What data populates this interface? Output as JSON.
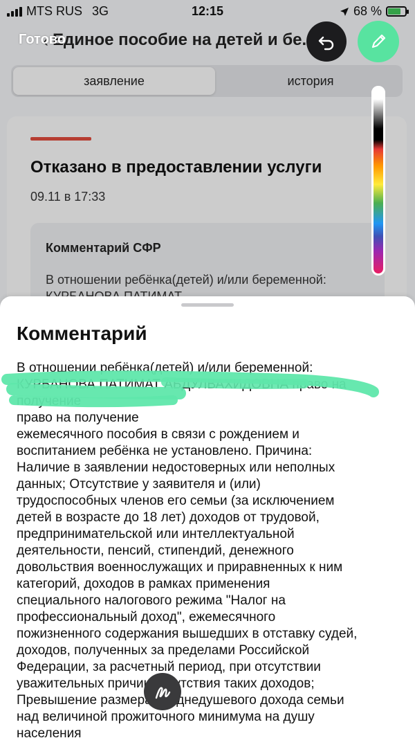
{
  "status_bar": {
    "carrier": "MTS RUS",
    "network": "3G",
    "time": "12:15",
    "battery_percent": "68 %",
    "battery_level": 0.68
  },
  "header": {
    "done_label": "Готово",
    "title": "Единое пособие на детей и бе..."
  },
  "tabs": [
    {
      "label": "заявление",
      "active": true
    },
    {
      "label": "история",
      "active": false
    }
  ],
  "card": {
    "title": "Отказано в предоставлении услуги",
    "date": "09.11 в 17:33",
    "comment_title": "Комментарий СФР",
    "comment_preview": "В отношении ребёнка(детей) и/или беременной: КУРБАНОВА ПАТИМАТ"
  },
  "sheet": {
    "title": "Комментарий",
    "text": "В отношении ребёнка(детей) и/или беременной:\nКУРБАНОВА ПАТИМАТ АБДУЛВАХИДОВНА право на получение\nправо на получение\nежемесячного пособия в связи с рождением и\nвоспитанием ребёнка не установлено. Причина:\nНаличие в заявлении недостоверных или неполных\nданных; Отсутствие у заявителя и (или)\nтрудоспособных членов его семьи (за исключением\nдетей в возрасте до 18 лет) доходов от трудовой,\nпредпринимательской или интеллектуальной\nдеятельности, пенсий, стипендий, денежного\nдовольствия военнослужащих и приравненных к ним\nкатегорий, доходов в рамках применения\nспециального налогового режима \"Налог на\nпрофессиональный доход\", ежемесячного\nпожизненного содержания вышедших в отставку судей,\nдоходов, полученных за пределами Российской\nФедерации, за расчетный период, при отсутствии\nуважительных причин отсутствия таких доходов;\nПревышение размера среднедушевого дохода семьи\nнад величиной прожиточного минимума на душу\nнаселения"
  },
  "colors": {
    "accent_green": "#58e3a0",
    "status_red": "#d9493b",
    "highlighter": "#5fe7ab"
  },
  "icons": {
    "undo": "undo-icon",
    "pen": "pen-icon",
    "markup": "markup-icon",
    "location": "location-arrow-icon",
    "battery": "battery-charging-icon"
  }
}
